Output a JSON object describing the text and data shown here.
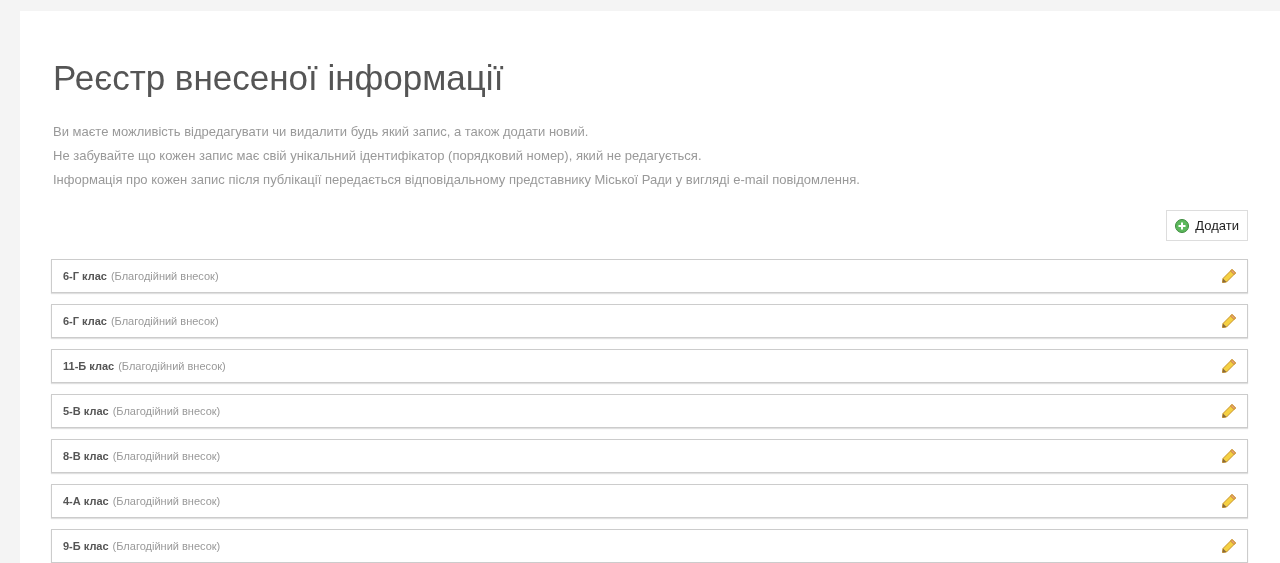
{
  "title": "Реєстр внесеної інформації",
  "intro": [
    "Ви маєте можливість відредагувати чи видалити будь який запис, а також додати новий.",
    "Не забувайте що кожен запис має свій унікальний ідентифікатор (порядковий номер), який не редагується.",
    "Інформація про кожен запис після публікації передається відповідальному представнику Міської Ради у вигляді e-mail повідомлення."
  ],
  "add_button": {
    "label": "Додати"
  },
  "records": [
    {
      "name": "6-Г клас",
      "note": "(Благодійний внесок)"
    },
    {
      "name": "6-Г клас",
      "note": "(Благодійний внесок)"
    },
    {
      "name": "11-Б клас",
      "note": "(Благодійний внесок)"
    },
    {
      "name": "5-В клас",
      "note": "(Благодійний внесок)"
    },
    {
      "name": "8-В клас",
      "note": "(Благодійний внесок)"
    },
    {
      "name": "4-А клас",
      "note": "(Благодійний внесок)"
    },
    {
      "name": "9-Б клас",
      "note": "(Благодійний внесок)"
    }
  ]
}
